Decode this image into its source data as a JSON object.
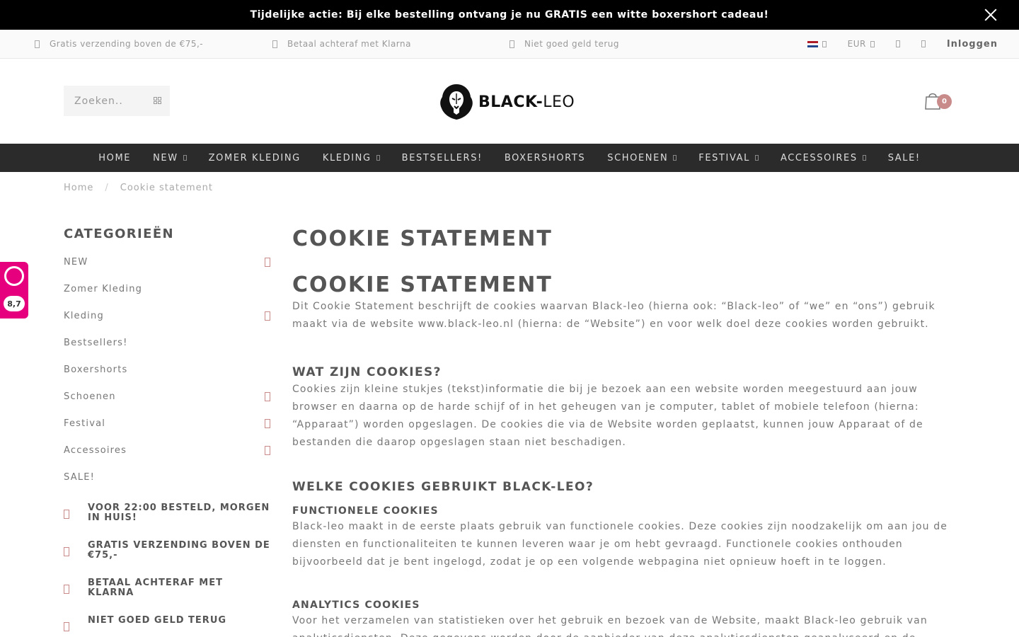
{
  "promo": {
    "text": "Tijdelijke actie: Bij elke bestelling ontvang je nu GRATIS een witte boxershort cadeau!"
  },
  "topbar": {
    "usps": [
      "Gratis verzending boven de €75,-",
      "Betaal achteraf met Klarna",
      "Niet goed geld terug"
    ],
    "currency": "EUR",
    "login": "Inloggen"
  },
  "header": {
    "search_placeholder": "Zoeken..",
    "logo_bold": "BLACK-",
    "logo_light": "LEO",
    "cart_count": "0"
  },
  "nav": [
    {
      "label": "HOME",
      "dropdown": false
    },
    {
      "label": "NEW",
      "dropdown": true
    },
    {
      "label": "ZOMER KLEDING",
      "dropdown": false
    },
    {
      "label": "KLEDING",
      "dropdown": true
    },
    {
      "label": "BESTSELLERS!",
      "dropdown": false
    },
    {
      "label": "BOXERSHORTS",
      "dropdown": false
    },
    {
      "label": "SCHOENEN",
      "dropdown": true
    },
    {
      "label": "FESTIVAL",
      "dropdown": true
    },
    {
      "label": "ACCESSOIRES",
      "dropdown": true
    },
    {
      "label": "SALE!",
      "dropdown": false
    }
  ],
  "breadcrumb": {
    "home": "Home",
    "sep": "/",
    "current": "Cookie statement"
  },
  "sidebar": {
    "title": "CATEGORIEËN",
    "categories": [
      {
        "label": "NEW",
        "expandable": true
      },
      {
        "label": "Zomer Kleding",
        "expandable": false
      },
      {
        "label": "Kleding",
        "expandable": true
      },
      {
        "label": "Bestsellers!",
        "expandable": false
      },
      {
        "label": "Boxershorts",
        "expandable": false
      },
      {
        "label": "Schoenen",
        "expandable": true
      },
      {
        "label": "Festival",
        "expandable": true
      },
      {
        "label": "Accessoires",
        "expandable": true
      },
      {
        "label": "SALE!",
        "expandable": false
      }
    ],
    "usps": [
      "VOOR 22:00 BESTELD, MORGEN IN HUIS!",
      "GRATIS VERZENDING BOVEN DE €75,-",
      "BETAAL ACHTERAF MET KLARNA",
      "NIET GOED GELD TERUG"
    ]
  },
  "kiyoh": {
    "score": "8,7"
  },
  "content": {
    "title": "COOKIE STATEMENT",
    "heading": "COOKIE STATEMENT",
    "intro": "Dit Cookie Statement beschrijft de cookies waarvan Black-leo (hierna ook: “Black-leo” of “we” en “ons”) gebruik maakt via de website www.black-leo.nl (hierna: de “Website”) en voor welk doel deze cookies worden gebruikt.",
    "h_what": "WAT ZIJN COOKIES?",
    "p_what": "Cookies zijn kleine stukjes (tekst)informatie die bij je bezoek aan een website worden meegestuurd aan jouw browser en daarna op de harde schijf of in het geheugen van je computer, tablet of mobiele telefoon (hierna: “Apparaat”) worden opgeslagen. De cookies die via de Website worden geplaatst, kunnen jouw Apparaat of de bestanden die daarop opgeslagen staan niet beschadigen.",
    "h_which": "WELKE COOKIES GEBRUIKT BLACK-LEO?",
    "h_functional": "FUNCTIONELE COOKIES",
    "p_functional": "Black-leo maakt in de eerste plaats gebruik van functionele cookies. Deze cookies zijn noodzakelijk om aan jou de diensten en functionaliteiten te kunnen leveren waar je om hebt gevraagd. Functionele cookies onthouden bijvoorbeeld dat je bent ingelogd, zodat je op een volgende webpagina niet opnieuw hoeft in te loggen.",
    "h_analytics": "ANALYTICS COOKIES",
    "p_analytics": "Voor het verzamelen van statistieken over het gebruik en bezoek van de Website, maakt Black-leo gebruik van analyticsdiensten. Deze gegevens worden door de aanbieder van deze analyticsdiensten geanalyseerd en de"
  }
}
